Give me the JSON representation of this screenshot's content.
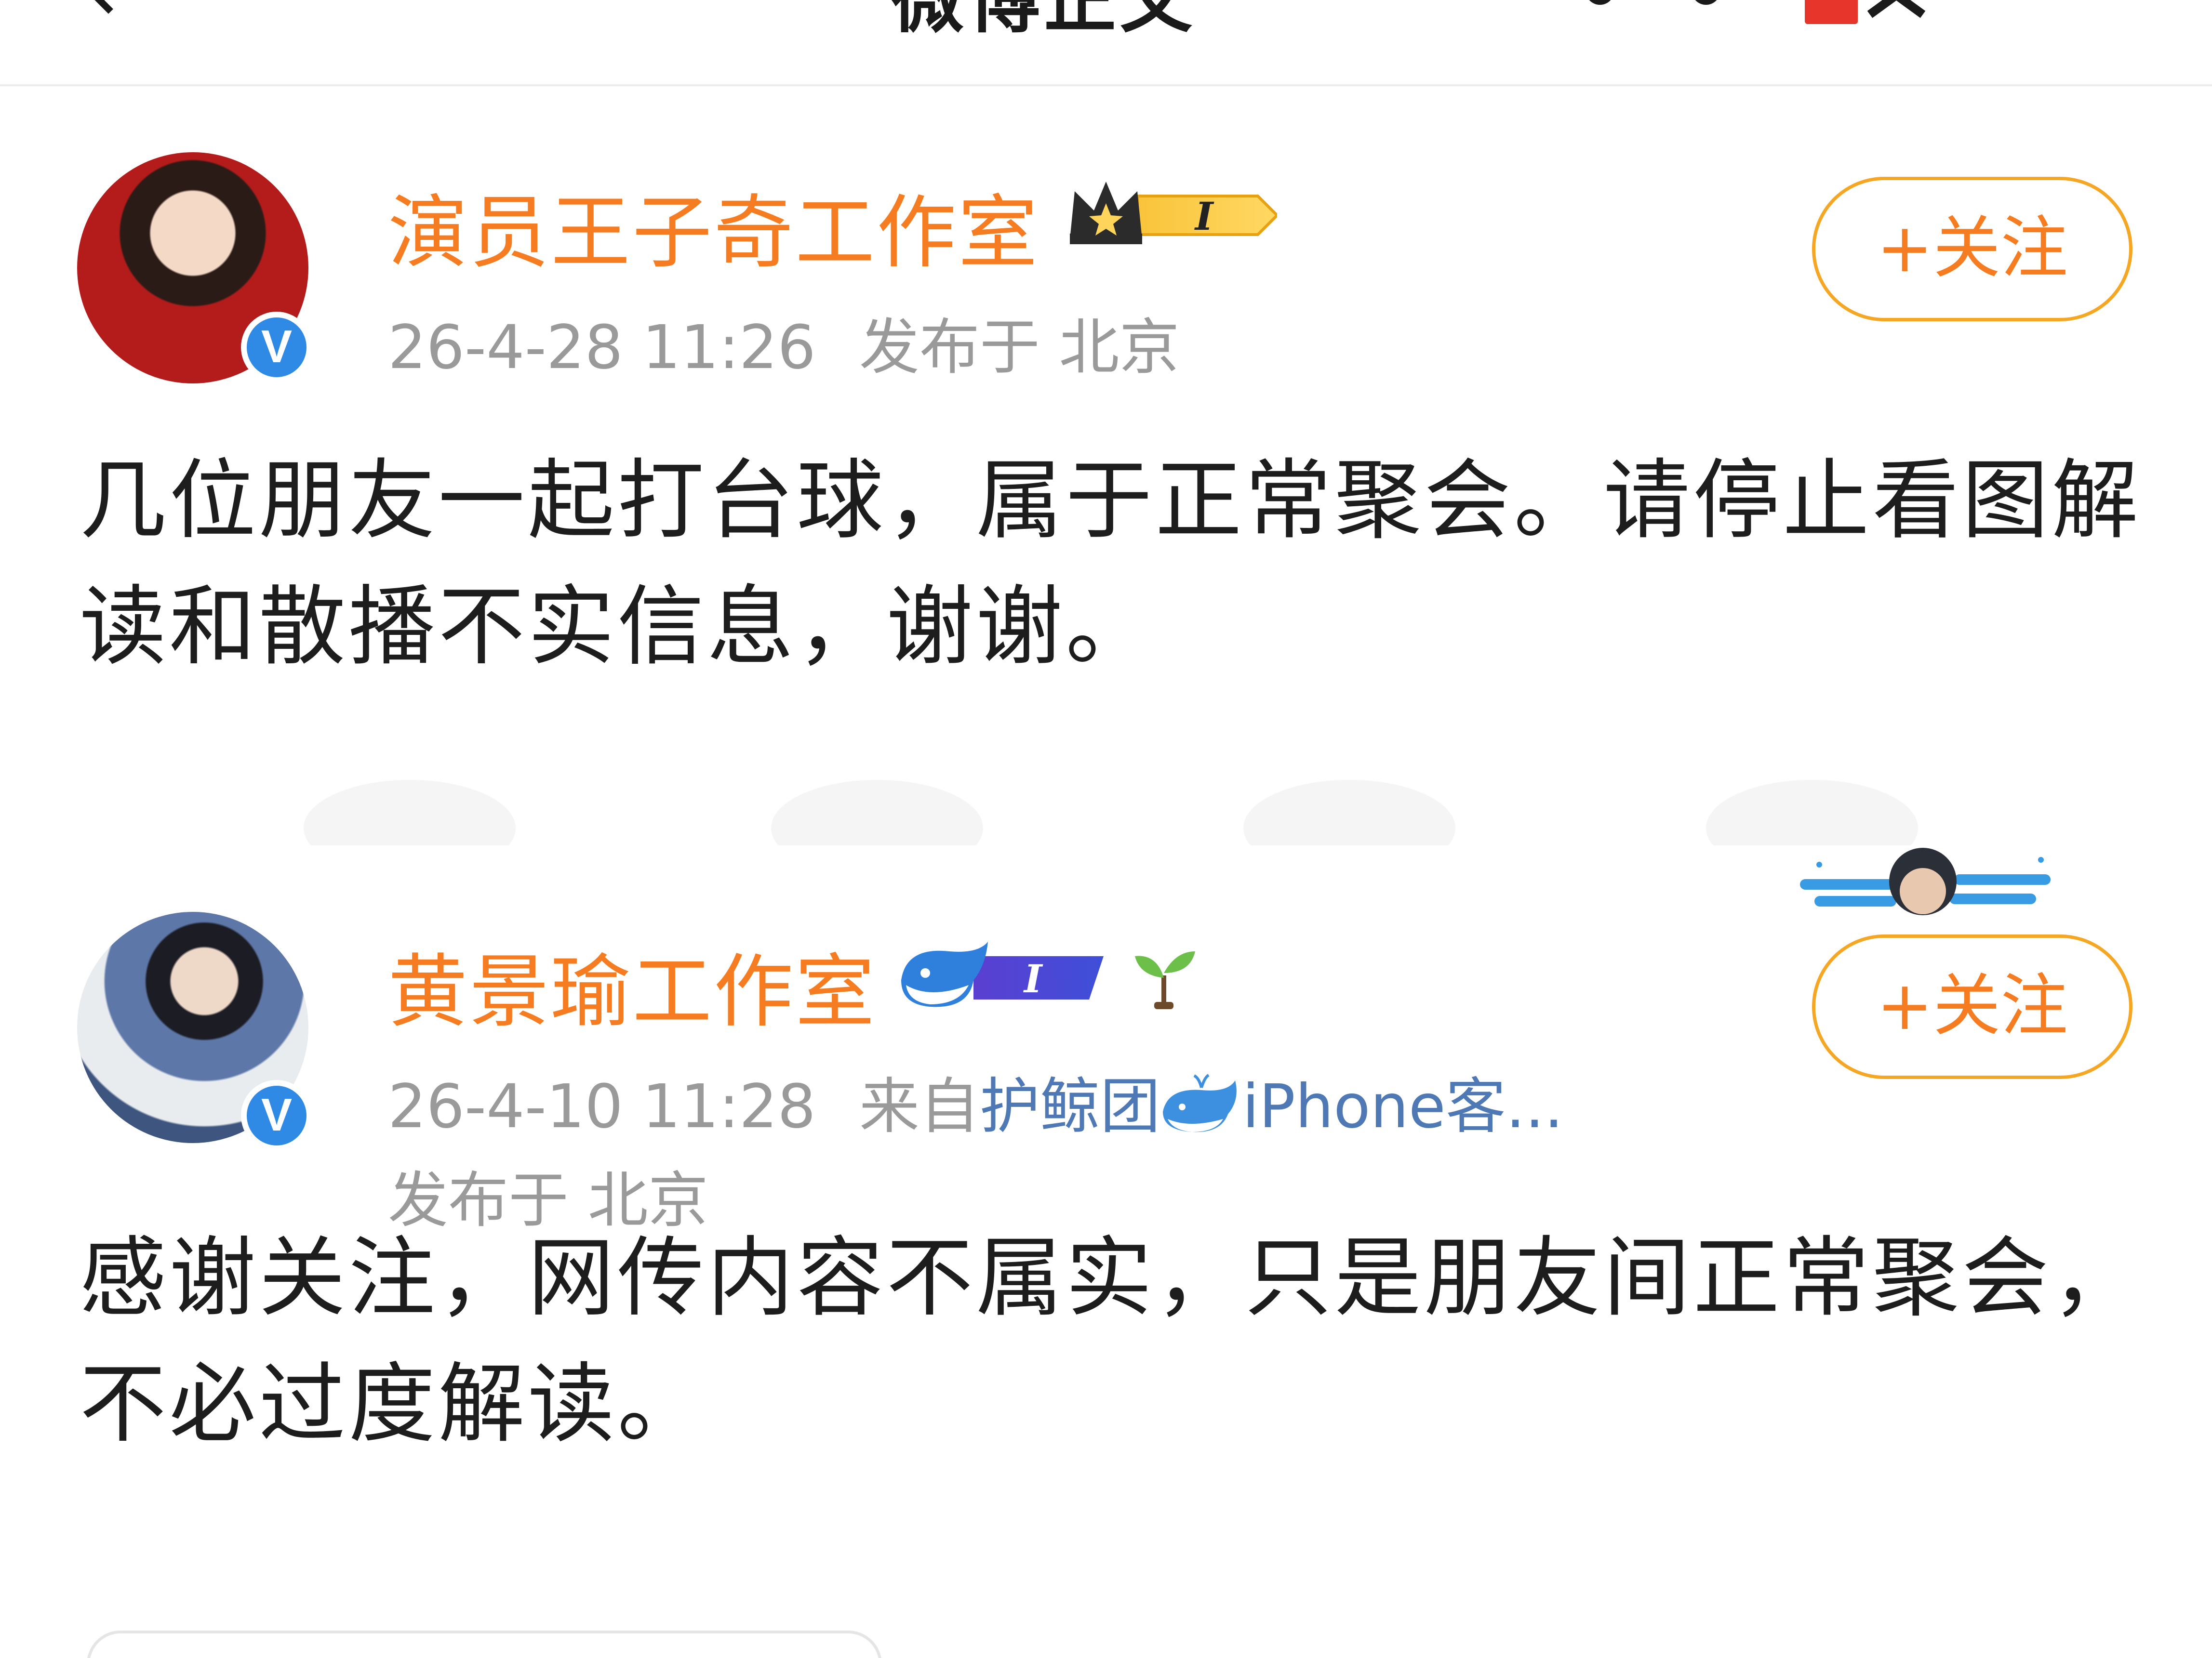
{
  "nav": {
    "title": "微博正文",
    "icons": [
      "back-icon",
      "music-icon",
      "notification-badge",
      "close-icon"
    ]
  },
  "posts": [
    {
      "username": "演员王子奇工作室",
      "badges": [
        "vip-crown-badge",
        "verified-badge"
      ],
      "vip_level": "I",
      "timestamp": "26-4-28 11:26",
      "location": "发布于 北京",
      "follow_label": "+关注",
      "content": "几位朋友一起打台球，属于正常聚会。请停止看图解读和散播不实信息，谢谢。"
    },
    {
      "username": "黄景瑜工作室",
      "badges": [
        "vip-whale-badge",
        "sprout-icon",
        "verified-badge"
      ],
      "vip_level": "I",
      "timestamp": "26-4-10 11:28",
      "source_prefix": "来自",
      "source": "护鲸团",
      "source_device": "iPhone客...",
      "location": "发布于 北京",
      "follow_label": "+关注",
      "content": "感谢关注，网传内容不属实，只是朋友间正常聚会，不必过度解读。"
    }
  ],
  "colors": {
    "username": "#f57c20",
    "follow_border": "#f5a623",
    "meta": "#9a9a9a",
    "source_link": "#4f79b5",
    "verified": "#2f8ae6"
  }
}
